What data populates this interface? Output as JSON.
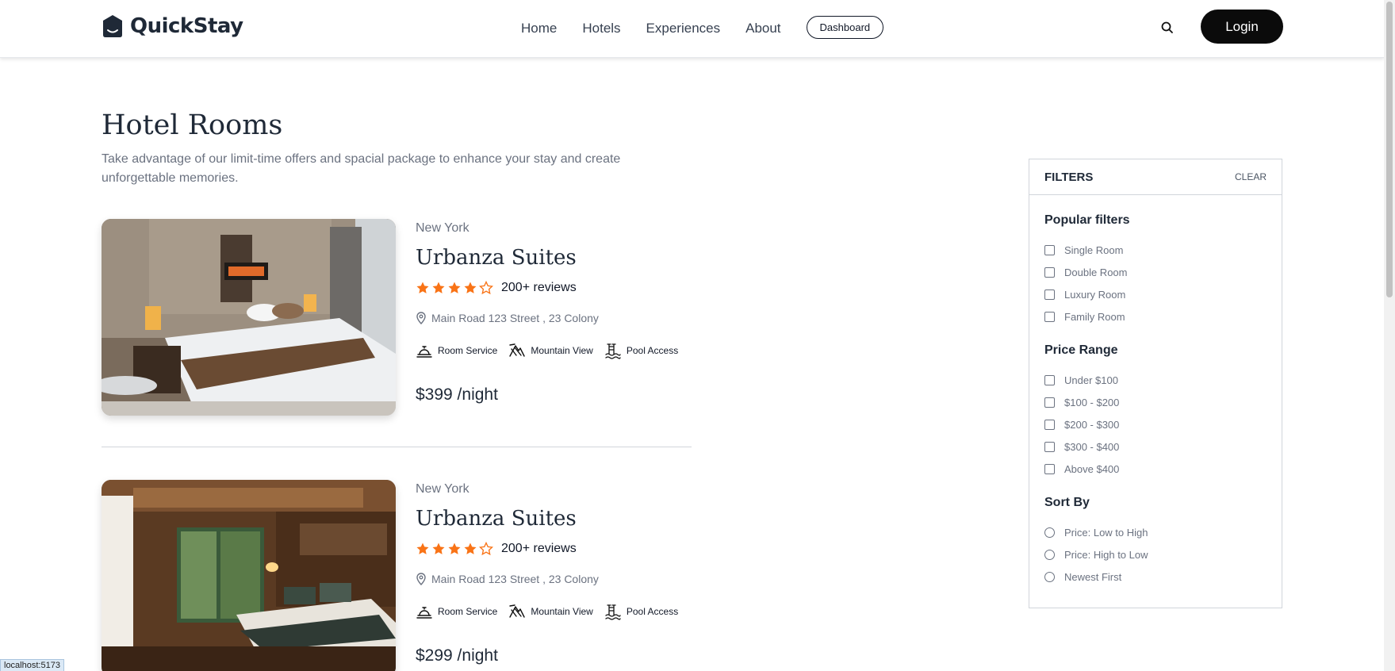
{
  "brand": {
    "name": "QuickStay"
  },
  "nav": {
    "links": [
      "Home",
      "Hotels",
      "Experiences",
      "About"
    ],
    "dashboard_label": "Dashboard",
    "login_label": "Login",
    "search_icon": "search-icon"
  },
  "header": {
    "title": "Hotel Rooms",
    "subtitle": "Take advantage of our limit-time offers and spacial package to enhance your stay and create unforgettable memories."
  },
  "rooms": [
    {
      "city": "New York",
      "name": "Urbanza Suites",
      "rating": 4,
      "reviews": "200+ reviews",
      "address": "Main Road 123 Street , 23 Colony",
      "amenities": [
        "Room Service",
        "Mountain View",
        "Pool Access"
      ],
      "price": "$399 /night"
    },
    {
      "city": "New York",
      "name": "Urbanza Suites",
      "rating": 4,
      "reviews": "200+ reviews",
      "address": "Main Road 123 Street , 23 Colony",
      "amenities": [
        "Room Service",
        "Mountain View",
        "Pool Access"
      ],
      "price": "$299 /night"
    }
  ],
  "filters": {
    "title": "FILTERS",
    "clear_label": "CLEAR",
    "popular": {
      "title": "Popular filters",
      "options": [
        "Single Room",
        "Double Room",
        "Luxury Room",
        "Family Room"
      ]
    },
    "price": {
      "title": "Price Range",
      "options": [
        "Under $100",
        "$100 - $200",
        "$200 - $300",
        "$300 - $400",
        "Above $400"
      ]
    },
    "sort": {
      "title": "Sort By",
      "options": [
        "Price: Low to High",
        "Price: High to Low",
        "Newest First"
      ]
    }
  },
  "status_bar": {
    "url": "localhost:5173"
  },
  "colors": {
    "accent_star": "#f97316",
    "button_dark": "#0b0b0b"
  }
}
